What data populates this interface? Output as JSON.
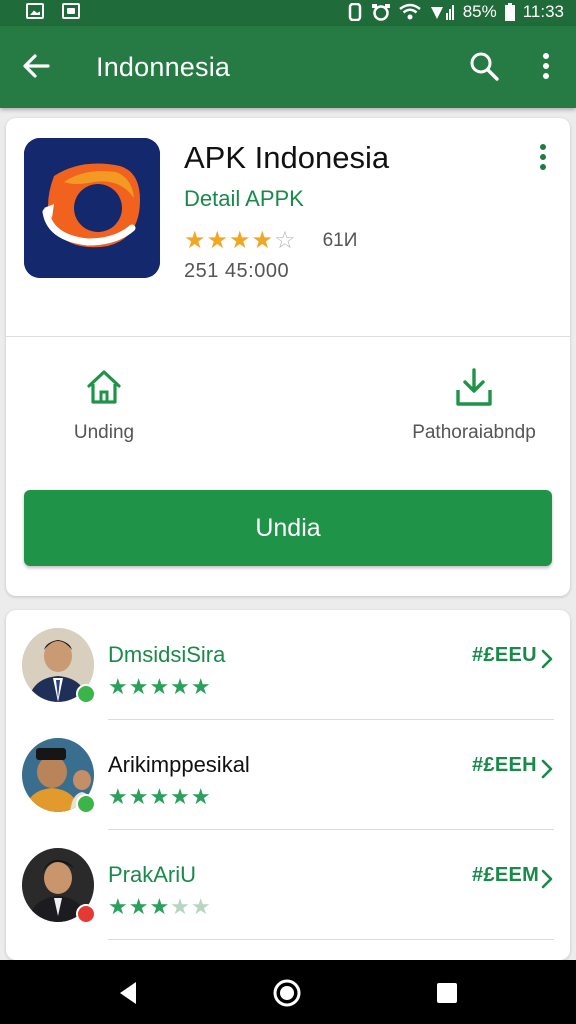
{
  "status_bar": {
    "battery": "85%",
    "time": "11:33"
  },
  "app_bar": {
    "title": "Indonnesia"
  },
  "app": {
    "name": "APK Indonesia",
    "subtitle": "Detail APPK",
    "rating_stars": 4,
    "rating_count": "61И",
    "meta": "251  45:000"
  },
  "actions": {
    "left_label": "Unding",
    "right_label": "Pathoraiabndp"
  },
  "install_button": {
    "label": "Undia"
  },
  "reviews": [
    {
      "name": "DmsidsiSira",
      "tag": "#£EEU",
      "stars": 5,
      "name_color": "#1a8a4a",
      "badge_color": "#3bb54a"
    },
    {
      "name": "Arikimppesikal",
      "tag": "#£EEH",
      "stars": 5,
      "name_color": "#111111",
      "badge_color": "#3bb54a"
    },
    {
      "name": "PrakAriU",
      "tag": "#£EEM",
      "stars": 3,
      "name_color": "#1a8a4a",
      "badge_color": "#e53935"
    }
  ],
  "colors": {
    "app_bar": "#267a44",
    "accent_green": "#1f9449",
    "star_gold": "#f0a726"
  }
}
